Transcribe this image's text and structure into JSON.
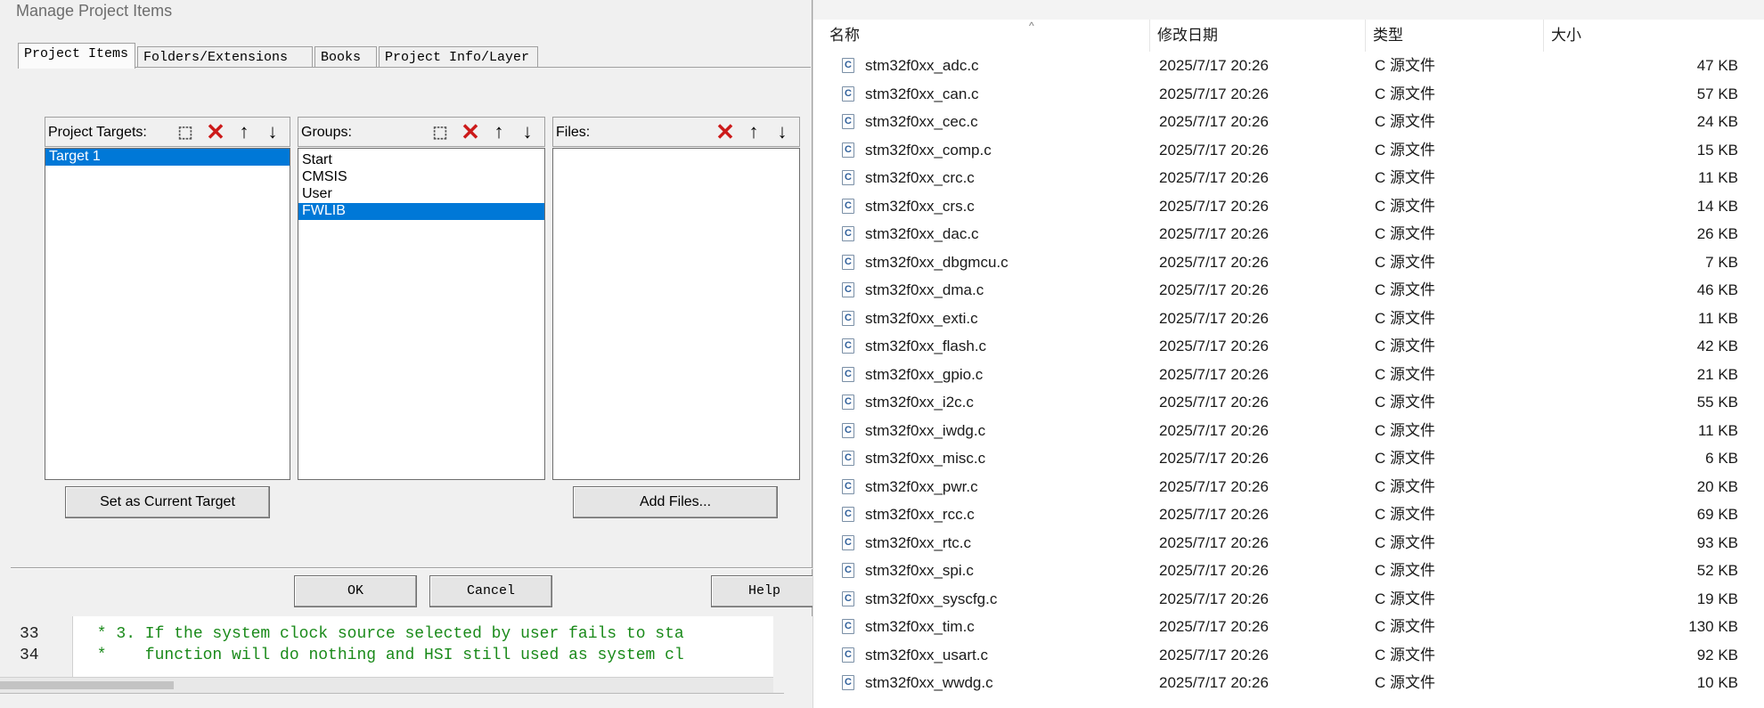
{
  "dialog": {
    "title": "Manage Project Items",
    "tabs": [
      {
        "label": "Project Items"
      },
      {
        "label": "Folders/Extensions"
      },
      {
        "label": "Books"
      },
      {
        "label": "Project Info/Layer"
      }
    ],
    "targets": {
      "label": "Project Targets:",
      "items": [
        "Target 1"
      ],
      "selected": "Target 1"
    },
    "groups": {
      "label": "Groups:",
      "items": [
        "Start",
        "CMSIS",
        "User",
        "FWLIB"
      ],
      "selected": "FWLIB"
    },
    "files": {
      "label": "Files:",
      "items": []
    },
    "set_current_target_label": "Set as Current Target",
    "add_files_label": "Add Files...",
    "ok_label": "OK",
    "cancel_label": "Cancel",
    "help_label": "Help"
  },
  "editor": {
    "lines": [
      {
        "num": "33",
        "text": " * 3. If the system clock source selected by user fails to sta"
      },
      {
        "num": "34",
        "text": " *    function will do nothing and HSI still used as system cl"
      }
    ]
  },
  "explorer": {
    "columns": {
      "name": "名称",
      "date": "修改日期",
      "type": "类型",
      "size": "大小"
    },
    "files": [
      {
        "name": "stm32f0xx_adc.c",
        "date": "2025/7/17 20:26",
        "type": "C 源文件",
        "size": "47 KB"
      },
      {
        "name": "stm32f0xx_can.c",
        "date": "2025/7/17 20:26",
        "type": "C 源文件",
        "size": "57 KB"
      },
      {
        "name": "stm32f0xx_cec.c",
        "date": "2025/7/17 20:26",
        "type": "C 源文件",
        "size": "24 KB"
      },
      {
        "name": "stm32f0xx_comp.c",
        "date": "2025/7/17 20:26",
        "type": "C 源文件",
        "size": "15 KB"
      },
      {
        "name": "stm32f0xx_crc.c",
        "date": "2025/7/17 20:26",
        "type": "C 源文件",
        "size": "11 KB"
      },
      {
        "name": "stm32f0xx_crs.c",
        "date": "2025/7/17 20:26",
        "type": "C 源文件",
        "size": "14 KB"
      },
      {
        "name": "stm32f0xx_dac.c",
        "date": "2025/7/17 20:26",
        "type": "C 源文件",
        "size": "26 KB"
      },
      {
        "name": "stm32f0xx_dbgmcu.c",
        "date": "2025/7/17 20:26",
        "type": "C 源文件",
        "size": "7 KB"
      },
      {
        "name": "stm32f0xx_dma.c",
        "date": "2025/7/17 20:26",
        "type": "C 源文件",
        "size": "46 KB"
      },
      {
        "name": "stm32f0xx_exti.c",
        "date": "2025/7/17 20:26",
        "type": "C 源文件",
        "size": "11 KB"
      },
      {
        "name": "stm32f0xx_flash.c",
        "date": "2025/7/17 20:26",
        "type": "C 源文件",
        "size": "42 KB"
      },
      {
        "name": "stm32f0xx_gpio.c",
        "date": "2025/7/17 20:26",
        "type": "C 源文件",
        "size": "21 KB"
      },
      {
        "name": "stm32f0xx_i2c.c",
        "date": "2025/7/17 20:26",
        "type": "C 源文件",
        "size": "55 KB"
      },
      {
        "name": "stm32f0xx_iwdg.c",
        "date": "2025/7/17 20:26",
        "type": "C 源文件",
        "size": "11 KB"
      },
      {
        "name": "stm32f0xx_misc.c",
        "date": "2025/7/17 20:26",
        "type": "C 源文件",
        "size": "6 KB"
      },
      {
        "name": "stm32f0xx_pwr.c",
        "date": "2025/7/17 20:26",
        "type": "C 源文件",
        "size": "20 KB"
      },
      {
        "name": "stm32f0xx_rcc.c",
        "date": "2025/7/17 20:26",
        "type": "C 源文件",
        "size": "69 KB"
      },
      {
        "name": "stm32f0xx_rtc.c",
        "date": "2025/7/17 20:26",
        "type": "C 源文件",
        "size": "93 KB"
      },
      {
        "name": "stm32f0xx_spi.c",
        "date": "2025/7/17 20:26",
        "type": "C 源文件",
        "size": "52 KB"
      },
      {
        "name": "stm32f0xx_syscfg.c",
        "date": "2025/7/17 20:26",
        "type": "C 源文件",
        "size": "19 KB"
      },
      {
        "name": "stm32f0xx_tim.c",
        "date": "2025/7/17 20:26",
        "type": "C 源文件",
        "size": "130 KB"
      },
      {
        "name": "stm32f0xx_usart.c",
        "date": "2025/7/17 20:26",
        "type": "C 源文件",
        "size": "92 KB"
      },
      {
        "name": "stm32f0xx_wwdg.c",
        "date": "2025/7/17 20:26",
        "type": "C 源文件",
        "size": "10 KB"
      }
    ]
  }
}
